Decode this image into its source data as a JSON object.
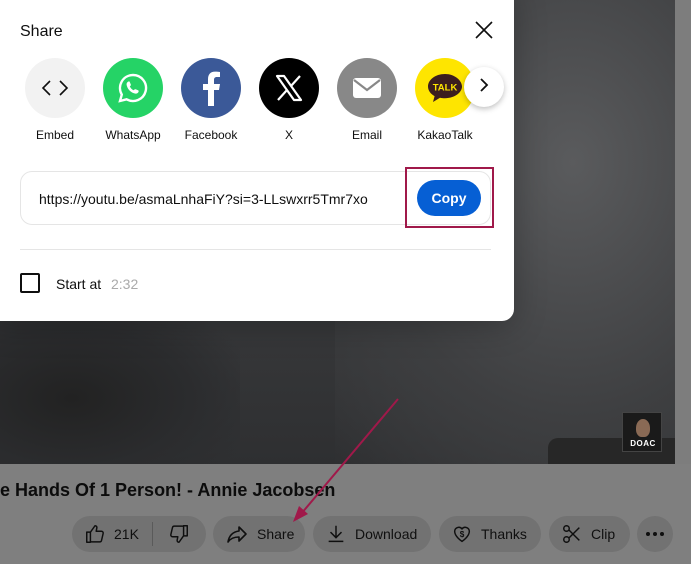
{
  "dialog": {
    "title": "Share",
    "targets": [
      {
        "label": "Embed",
        "icon": "embed-icon",
        "color": "#f2f2f2"
      },
      {
        "label": "WhatsApp",
        "icon": "whatsapp-icon",
        "color": "#25d366"
      },
      {
        "label": "Facebook",
        "icon": "facebook-icon",
        "color": "#3b5998"
      },
      {
        "label": "X",
        "icon": "x-icon",
        "color": "#000000"
      },
      {
        "label": "Email",
        "icon": "email-icon",
        "color": "#888888"
      },
      {
        "label": "KakaoTalk",
        "icon": "kakaotalk-icon",
        "color": "#fee500"
      }
    ],
    "kakao_badge": "TALK",
    "url": "https://youtu.be/asmaLnhaFiY?si=3-LLswxrr5Tmr7xo",
    "copy_label": "Copy",
    "start_at_label": "Start at",
    "start_at_time": "2:32",
    "start_at_checked": false
  },
  "video": {
    "title": "e Hands Of 1 Person! - Annie Jacobsen",
    "channel_badge": "DOAC"
  },
  "actions": {
    "likes": "21K",
    "share": "Share",
    "download": "Download",
    "thanks": "Thanks",
    "clip": "Clip"
  },
  "colors": {
    "accent": "#065fd4",
    "highlight": "#a0194a"
  }
}
